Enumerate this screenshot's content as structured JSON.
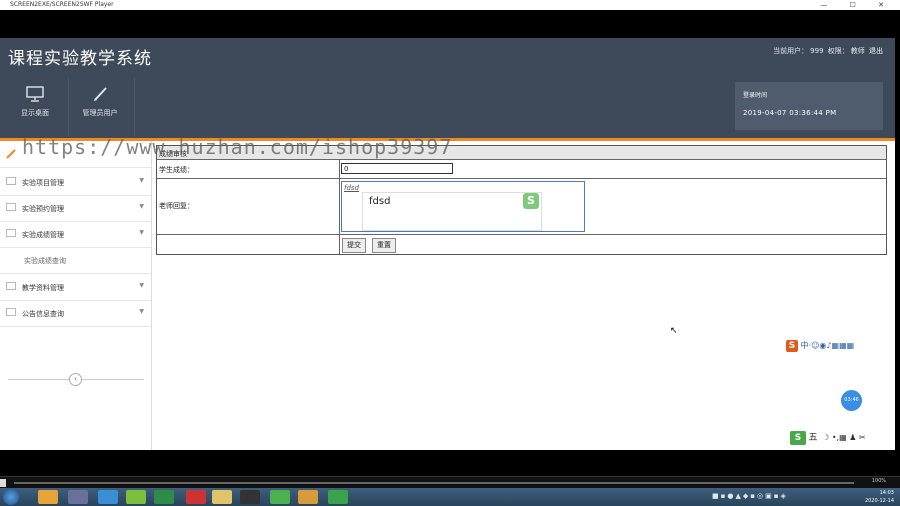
{
  "player": {
    "title": "SCREEN2EXE/SCREEN2SWF Player",
    "controls": "—  ☐  ✕",
    "zoom": "100%"
  },
  "app": {
    "title": "课程实验教学系统"
  },
  "header": {
    "user_label": "当前用户：",
    "user_value": "999",
    "perm_label": "权限：",
    "perm_value": "教师",
    "logout": "退出"
  },
  "toolbar": {
    "view_home": "显示桌面",
    "manage_users": "管理员用户"
  },
  "login_time": {
    "label": "登录时间",
    "value": "2019-04-07 03:36:44 PM"
  },
  "sidebar": {
    "items": [
      {
        "label": "实验项目管理"
      },
      {
        "label": "实验预约管理"
      },
      {
        "label": "实验成绩管理"
      },
      {
        "label": "实验成绩查询"
      },
      {
        "label": "教学资料管理"
      },
      {
        "label": "公告信息查询"
      }
    ],
    "collapse": "‹"
  },
  "form": {
    "title": "成绩审核",
    "score_label": "学生成绩：",
    "score_value": "0",
    "reply_label": "老师回复：",
    "reply_text": "fdsd",
    "ime_text": "fdsd",
    "submit": "提交",
    "reset": "重置"
  },
  "ime": {
    "logo": "S",
    "mode": "五"
  },
  "chat_bubble": "03:46",
  "watermark": "https://www.huzhan.com/ishop39397",
  "taskbar": {
    "time": "14:03",
    "date": "2020-12-14"
  },
  "colors": {
    "header": "#3e4a5a",
    "accent": "#f08a1f",
    "timebox": "#4f5c6e"
  }
}
